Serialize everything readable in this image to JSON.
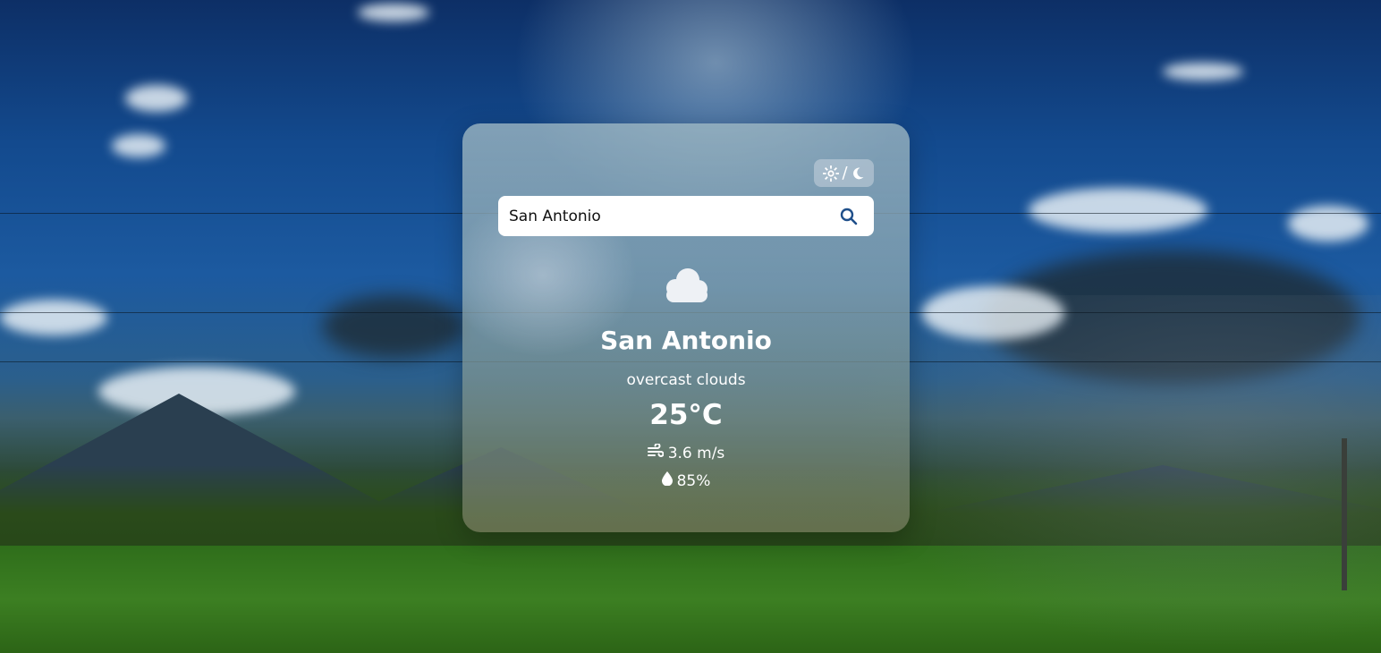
{
  "search": {
    "value": "San Antonio",
    "icon": "search-icon"
  },
  "theme_toggle": {
    "separator": "/",
    "icons": [
      "sun-icon",
      "moon-icon"
    ]
  },
  "weather": {
    "icon": "cloud-icon",
    "city": "San Antonio",
    "description": "overcast clouds",
    "temperature": "25°C",
    "wind": "3.6 m/s",
    "wind_icon": "wind-icon",
    "humidity": "85%",
    "humidity_icon": "droplet-icon"
  },
  "colors": {
    "text": "#ffffff",
    "search_icon": "#1f4f8a",
    "card_tint": "#9fb8c2"
  }
}
